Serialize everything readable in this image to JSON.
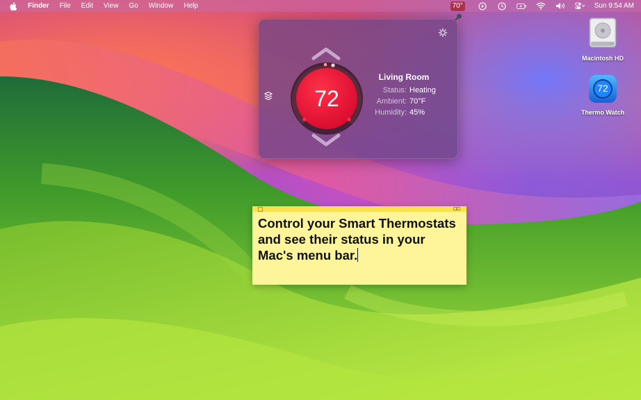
{
  "menubar": {
    "apple": "apple-menu",
    "items": [
      "Finder",
      "File",
      "Edit",
      "View",
      "Go",
      "Window",
      "Help"
    ],
    "temp": "70°",
    "clock": "Sun 9:54 AM"
  },
  "thermostat": {
    "setpoint": "72",
    "room": "Living Room",
    "status_label": "Status:",
    "status_value": "Heating",
    "ambient_label": "Ambient:",
    "ambient_value": "70°F",
    "humidity_label": "Humidity:",
    "humidity_value": "45%",
    "dial_color": "#e8123a"
  },
  "desktop": {
    "hd_label": "Macintosh HD",
    "app_label": "Thermo Watch",
    "app_badge": "72"
  },
  "sticky": {
    "text": "Control your Smart Thermostats and see their status in your Mac's menu bar."
  },
  "icons": [
    "apple-icon",
    "play-icon",
    "clock-icon",
    "battery-icon",
    "wifi-icon",
    "volume-icon",
    "control-center-icon",
    "gear-icon",
    "layers-icon",
    "chevron-up-icon",
    "chevron-down-icon",
    "pin-icon"
  ]
}
